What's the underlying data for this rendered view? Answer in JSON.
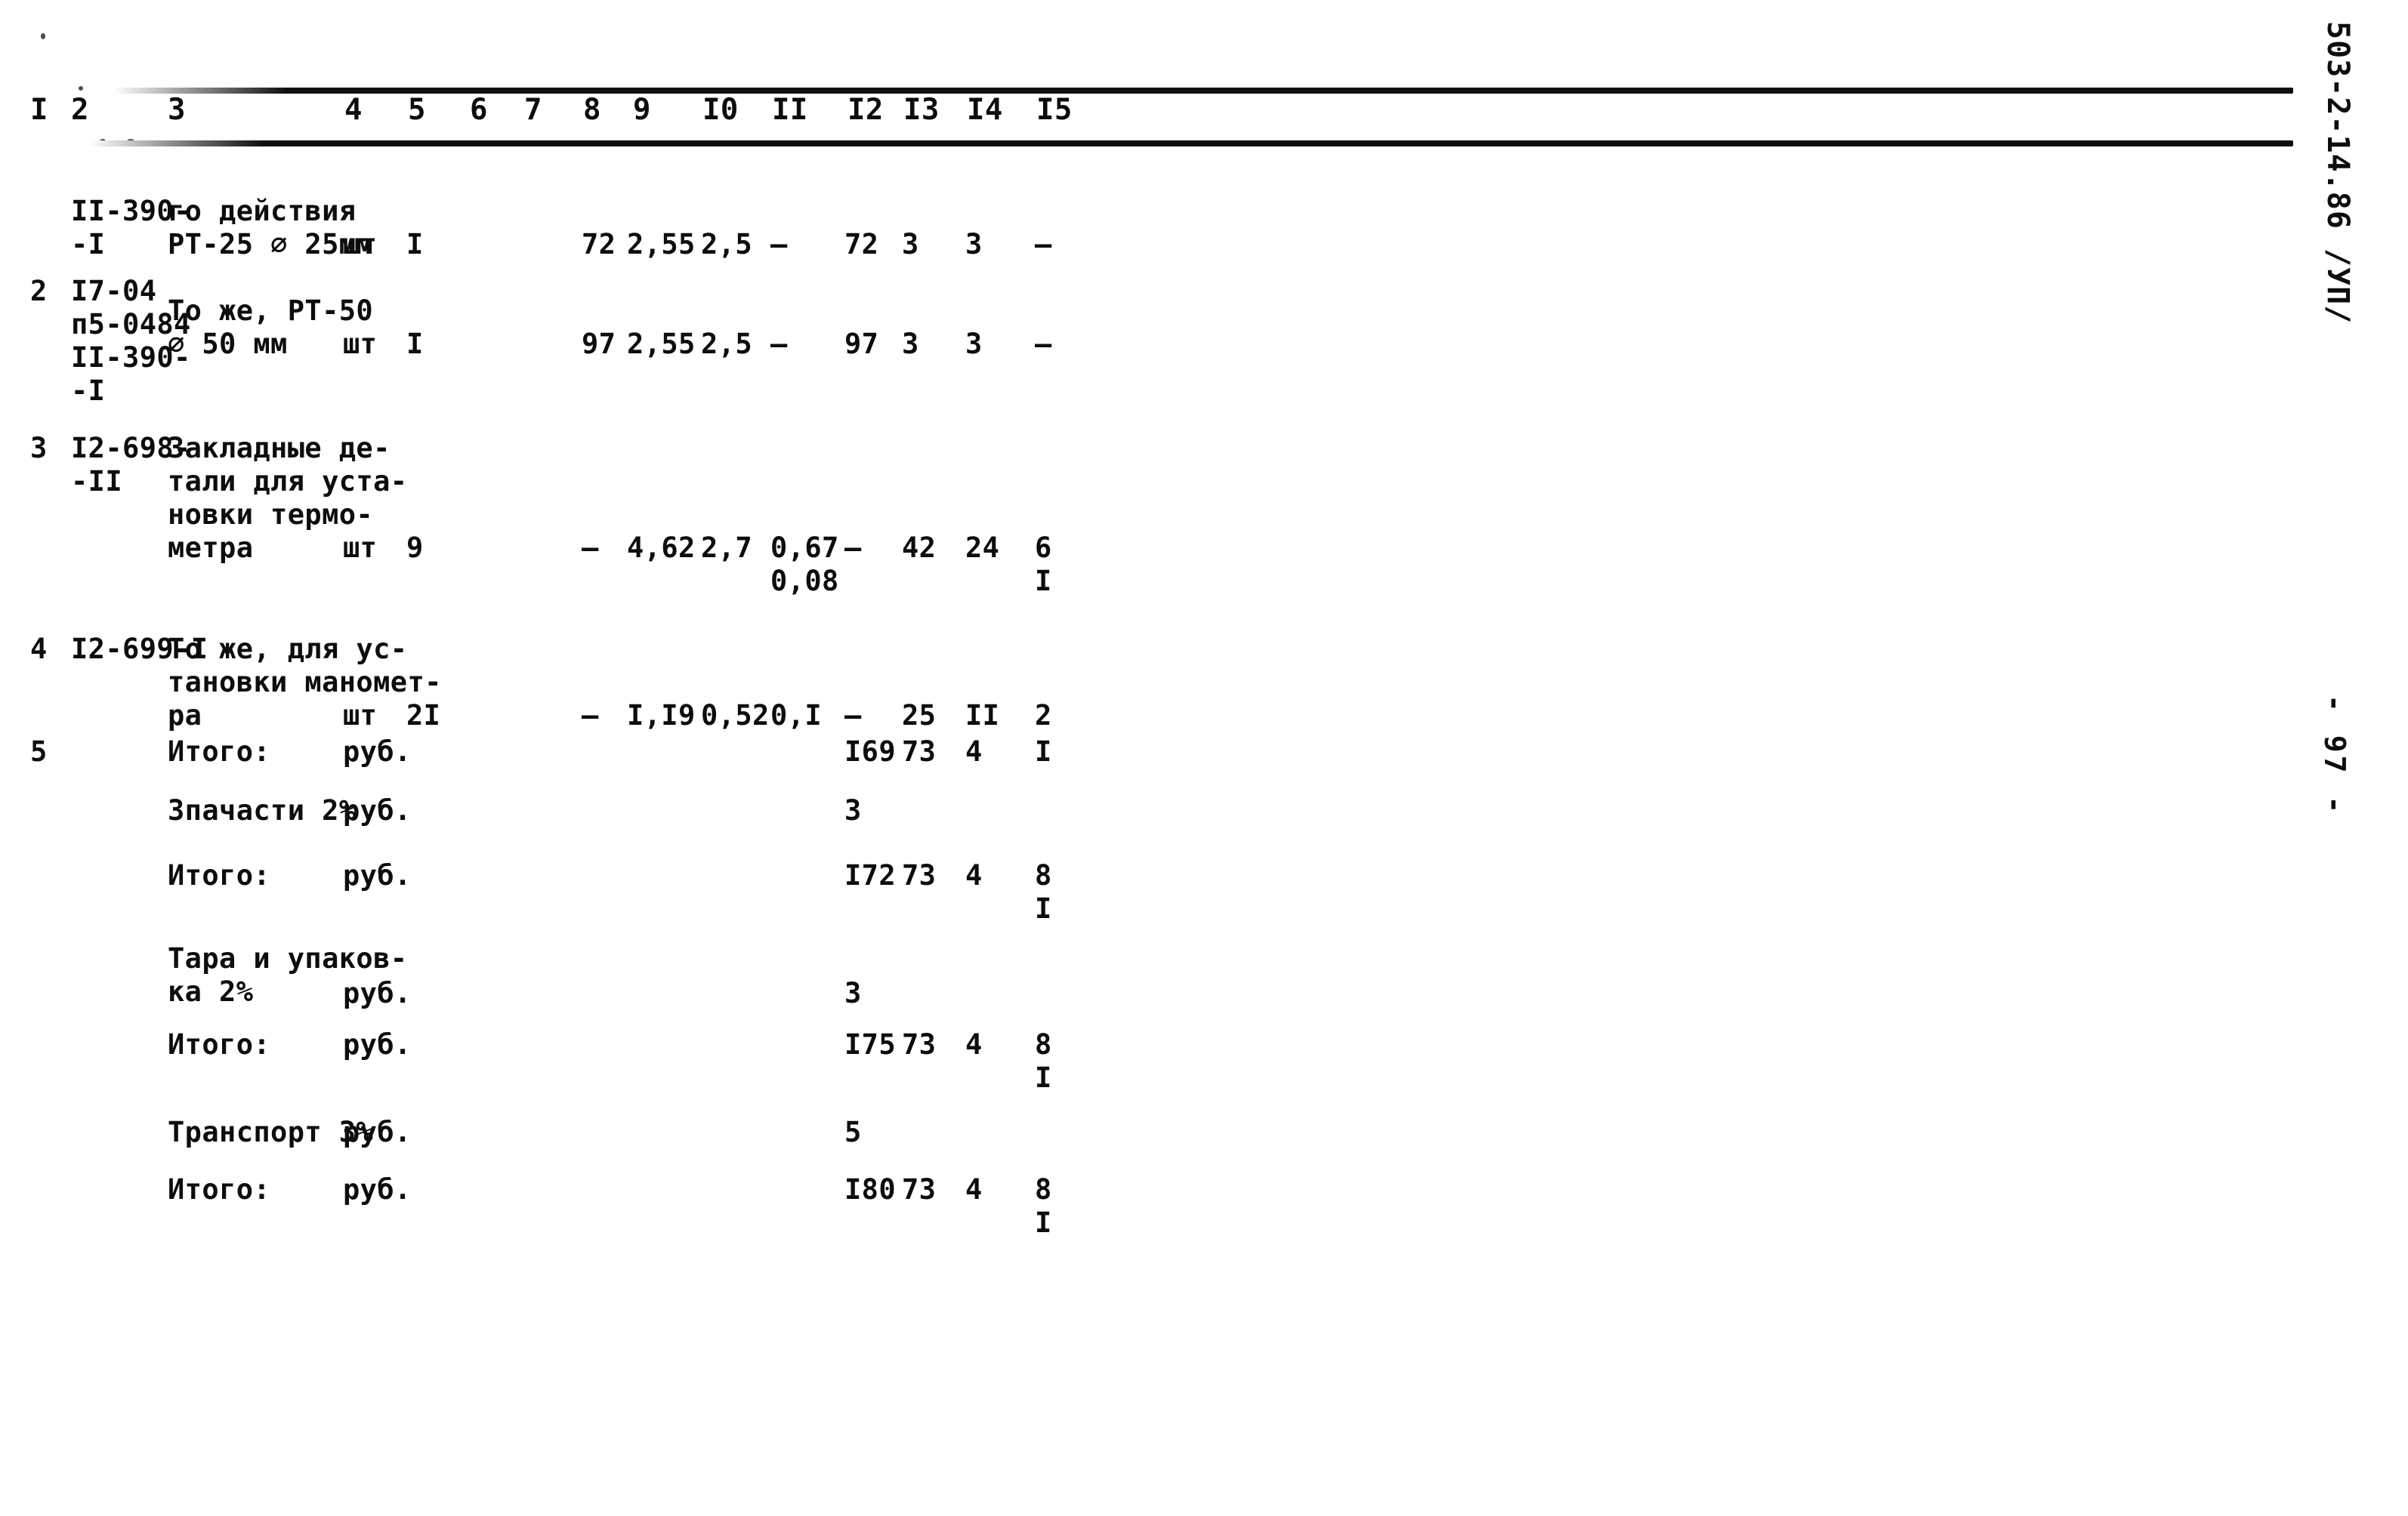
{
  "document": {
    "code_margin": "503-2-14.86 /УП/",
    "page_number": "- 97 -"
  },
  "table": {
    "column_headers": [
      "I",
      "2",
      "3",
      "4",
      "5",
      "6",
      "7",
      "8",
      "9",
      "I0",
      "II",
      "I2",
      "I3",
      "I4",
      "I5"
    ],
    "rows": [
      {
        "no": "",
        "code": "II-390-\n-I",
        "description": "го действия\nРТ-25 ⌀ 25мм",
        "unit": "шт",
        "qty": "I",
        "c6": "",
        "c7": "",
        "c8": "72",
        "c9": "2,55",
        "c10": "2,5",
        "c11": "–",
        "c12": "72",
        "c13": "3",
        "c14": "3",
        "c15": "–"
      },
      {
        "no": "2",
        "code": "I7-04\nп5-0484\nII-390-\n-I",
        "description": "То же, РТ-50\n⌀ 50 мм",
        "unit": "шт",
        "qty": "I",
        "c6": "",
        "c7": "",
        "c8": "97",
        "c9": "2,55",
        "c10": "2,5",
        "c11": "–",
        "c12": "97",
        "c13": "3",
        "c14": "3",
        "c15": "–"
      },
      {
        "no": "3",
        "code": "I2-698-\n-II",
        "description": "Закладные де-\nтали для уста-\nновки термо-\nметра",
        "unit": "шт",
        "qty": "9",
        "c6": "",
        "c7": "",
        "c8": "–",
        "c9": "4,62",
        "c10": "2,7",
        "c11": "0,67\n0,08",
        "c12": "–",
        "c13": "42",
        "c14": "24",
        "c15": "6\nI"
      },
      {
        "no": "4",
        "code": "I2-699-I",
        "description": "То же, для ус-\nтановки маномет-\nра",
        "unit": "шт",
        "qty": "2I",
        "c6": "",
        "c7": "",
        "c8": "–",
        "c9": "I,I9",
        "c10": "0,52",
        "c11": "0,I",
        "c12": "–",
        "c13": "25",
        "c14": "II",
        "c15": "2"
      }
    ],
    "summary_rows": [
      {
        "no": "5",
        "label": "Итого:",
        "unit": "руб.",
        "c12": "I69",
        "c13": "73",
        "c14": "4",
        "c15": "I"
      },
      {
        "no": "",
        "label": "Зпачасти 2%",
        "unit": "руб.",
        "c12": "3",
        "c13": "",
        "c14": "",
        "c15": ""
      },
      {
        "no": "",
        "label": "Итого:",
        "unit": "руб.",
        "c12": "I72",
        "c13": "73",
        "c14": "4",
        "c15": "8\nI"
      },
      {
        "no": "",
        "label": "Тара и упаков-\nка 2%",
        "unit": "руб.",
        "c12": "3",
        "c13": "",
        "c14": "",
        "c15": ""
      },
      {
        "no": "",
        "label": "Итого:",
        "unit": "руб.",
        "c12": "I75",
        "c13": "73",
        "c14": "4",
        "c15": "8\nI"
      },
      {
        "no": "",
        "label": "Транспорт 3%",
        "unit": "руб.",
        "c12": "5",
        "c13": "",
        "c14": "",
        "c15": ""
      },
      {
        "no": "",
        "label": "Итого:",
        "unit": "руб.",
        "c12": "I80",
        "c13": "73",
        "c14": "4",
        "c15": "8\nI"
      }
    ]
  }
}
